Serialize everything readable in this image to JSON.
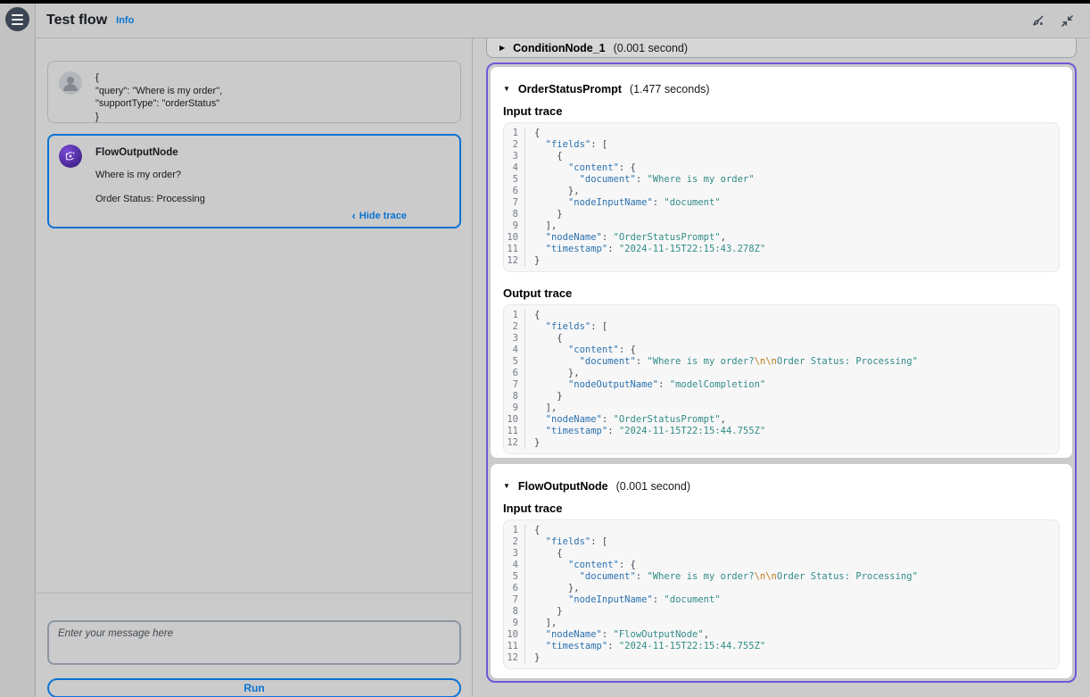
{
  "colors": {
    "accent_blue": "#0972d3",
    "trace_highlight_purple": "#7157d9",
    "code_key": "#2b71ae",
    "code_string": "#318c85",
    "code_escape": "#bd7c17",
    "page_background": "#cbcbcb"
  },
  "header": {
    "title": "Test flow",
    "info_label": "Info"
  },
  "chat": {
    "user_message": {
      "lines": [
        "{",
        "\"query\": \"Where is my order\",",
        "\"supportType\": \"orderStatus\"",
        "}"
      ]
    },
    "bot_message": {
      "title": "FlowOutputNode",
      "line1": "Where is my order?",
      "line2": "Order Status: Processing",
      "trace_link": "Hide trace",
      "trace_chevron": "‹"
    },
    "input_placeholder": "Enter your message here",
    "run_label": "Run"
  },
  "trace_panel": {
    "collapsed": {
      "triangle": "▶",
      "title": "ConditionNode_1",
      "duration": "(0.001 second)"
    },
    "expanded_triangle": "▼",
    "sections": [
      {
        "title": "OrderStatusPrompt",
        "duration": "(1.477 seconds)",
        "blocks": [
          {
            "heading": "Input trace",
            "lines": [
              [
                {
                  "c": "p",
                  "t": "{"
                }
              ],
              [
                {
                  "c": "p",
                  "t": "  "
                },
                {
                  "c": "k",
                  "t": "\"fields\""
                },
                {
                  "c": "p",
                  "t": ": ["
                }
              ],
              [
                {
                  "c": "p",
                  "t": "    {"
                }
              ],
              [
                {
                  "c": "p",
                  "t": "      "
                },
                {
                  "c": "k",
                  "t": "\"content\""
                },
                {
                  "c": "p",
                  "t": ": {"
                }
              ],
              [
                {
                  "c": "p",
                  "t": "        "
                },
                {
                  "c": "k",
                  "t": "\"document\""
                },
                {
                  "c": "p",
                  "t": ": "
                },
                {
                  "c": "s",
                  "t": "\"Where is my order\""
                }
              ],
              [
                {
                  "c": "p",
                  "t": "      },"
                }
              ],
              [
                {
                  "c": "p",
                  "t": "      "
                },
                {
                  "c": "k",
                  "t": "\"nodeInputName\""
                },
                {
                  "c": "p",
                  "t": ": "
                },
                {
                  "c": "s",
                  "t": "\"document\""
                }
              ],
              [
                {
                  "c": "p",
                  "t": "    }"
                }
              ],
              [
                {
                  "c": "p",
                  "t": "  ],"
                }
              ],
              [
                {
                  "c": "p",
                  "t": "  "
                },
                {
                  "c": "k",
                  "t": "\"nodeName\""
                },
                {
                  "c": "p",
                  "t": ": "
                },
                {
                  "c": "s",
                  "t": "\"OrderStatusPrompt\""
                },
                {
                  "c": "p",
                  "t": ","
                }
              ],
              [
                {
                  "c": "p",
                  "t": "  "
                },
                {
                  "c": "k",
                  "t": "\"timestamp\""
                },
                {
                  "c": "p",
                  "t": ": "
                },
                {
                  "c": "s",
                  "t": "\"2024-11-15T22:15:43.278Z\""
                }
              ],
              [
                {
                  "c": "p",
                  "t": "}"
                }
              ]
            ]
          },
          {
            "heading": "Output trace",
            "lines": [
              [
                {
                  "c": "p",
                  "t": "{"
                }
              ],
              [
                {
                  "c": "p",
                  "t": "  "
                },
                {
                  "c": "k",
                  "t": "\"fields\""
                },
                {
                  "c": "p",
                  "t": ": ["
                }
              ],
              [
                {
                  "c": "p",
                  "t": "    {"
                }
              ],
              [
                {
                  "c": "p",
                  "t": "      "
                },
                {
                  "c": "k",
                  "t": "\"content\""
                },
                {
                  "c": "p",
                  "t": ": {"
                }
              ],
              [
                {
                  "c": "p",
                  "t": "        "
                },
                {
                  "c": "k",
                  "t": "\"document\""
                },
                {
                  "c": "p",
                  "t": ": "
                },
                {
                  "c": "s",
                  "t": "\"Where is my order?"
                },
                {
                  "c": "e",
                  "t": "\\n\\n"
                },
                {
                  "c": "s",
                  "t": "Order Status: Processing\""
                }
              ],
              [
                {
                  "c": "p",
                  "t": "      },"
                }
              ],
              [
                {
                  "c": "p",
                  "t": "      "
                },
                {
                  "c": "k",
                  "t": "\"nodeOutputName\""
                },
                {
                  "c": "p",
                  "t": ": "
                },
                {
                  "c": "s",
                  "t": "\"modelCompletion\""
                }
              ],
              [
                {
                  "c": "p",
                  "t": "    }"
                }
              ],
              [
                {
                  "c": "p",
                  "t": "  ],"
                }
              ],
              [
                {
                  "c": "p",
                  "t": "  "
                },
                {
                  "c": "k",
                  "t": "\"nodeName\""
                },
                {
                  "c": "p",
                  "t": ": "
                },
                {
                  "c": "s",
                  "t": "\"OrderStatusPrompt\""
                },
                {
                  "c": "p",
                  "t": ","
                }
              ],
              [
                {
                  "c": "p",
                  "t": "  "
                },
                {
                  "c": "k",
                  "t": "\"timestamp\""
                },
                {
                  "c": "p",
                  "t": ": "
                },
                {
                  "c": "s",
                  "t": "\"2024-11-15T22:15:44.755Z\""
                }
              ],
              [
                {
                  "c": "p",
                  "t": "}"
                }
              ]
            ]
          }
        ]
      },
      {
        "title": "FlowOutputNode",
        "duration": "(0.001 second)",
        "blocks": [
          {
            "heading": "Input trace",
            "lines": [
              [
                {
                  "c": "p",
                  "t": "{"
                }
              ],
              [
                {
                  "c": "p",
                  "t": "  "
                },
                {
                  "c": "k",
                  "t": "\"fields\""
                },
                {
                  "c": "p",
                  "t": ": ["
                }
              ],
              [
                {
                  "c": "p",
                  "t": "    {"
                }
              ],
              [
                {
                  "c": "p",
                  "t": "      "
                },
                {
                  "c": "k",
                  "t": "\"content\""
                },
                {
                  "c": "p",
                  "t": ": {"
                }
              ],
              [
                {
                  "c": "p",
                  "t": "        "
                },
                {
                  "c": "k",
                  "t": "\"document\""
                },
                {
                  "c": "p",
                  "t": ": "
                },
                {
                  "c": "s",
                  "t": "\"Where is my order?"
                },
                {
                  "c": "e",
                  "t": "\\n\\n"
                },
                {
                  "c": "s",
                  "t": "Order Status: Processing\""
                }
              ],
              [
                {
                  "c": "p",
                  "t": "      },"
                }
              ],
              [
                {
                  "c": "p",
                  "t": "      "
                },
                {
                  "c": "k",
                  "t": "\"nodeInputName\""
                },
                {
                  "c": "p",
                  "t": ": "
                },
                {
                  "c": "s",
                  "t": "\"document\""
                }
              ],
              [
                {
                  "c": "p",
                  "t": "    }"
                }
              ],
              [
                {
                  "c": "p",
                  "t": "  ],"
                }
              ],
              [
                {
                  "c": "p",
                  "t": "  "
                },
                {
                  "c": "k",
                  "t": "\"nodeName\""
                },
                {
                  "c": "p",
                  "t": ": "
                },
                {
                  "c": "s",
                  "t": "\"FlowOutputNode\""
                },
                {
                  "c": "p",
                  "t": ","
                }
              ],
              [
                {
                  "c": "p",
                  "t": "  "
                },
                {
                  "c": "k",
                  "t": "\"timestamp\""
                },
                {
                  "c": "p",
                  "t": ": "
                },
                {
                  "c": "s",
                  "t": "\"2024-11-15T22:15:44.755Z\""
                }
              ],
              [
                {
                  "c": "p",
                  "t": "}"
                }
              ]
            ]
          }
        ]
      }
    ]
  }
}
